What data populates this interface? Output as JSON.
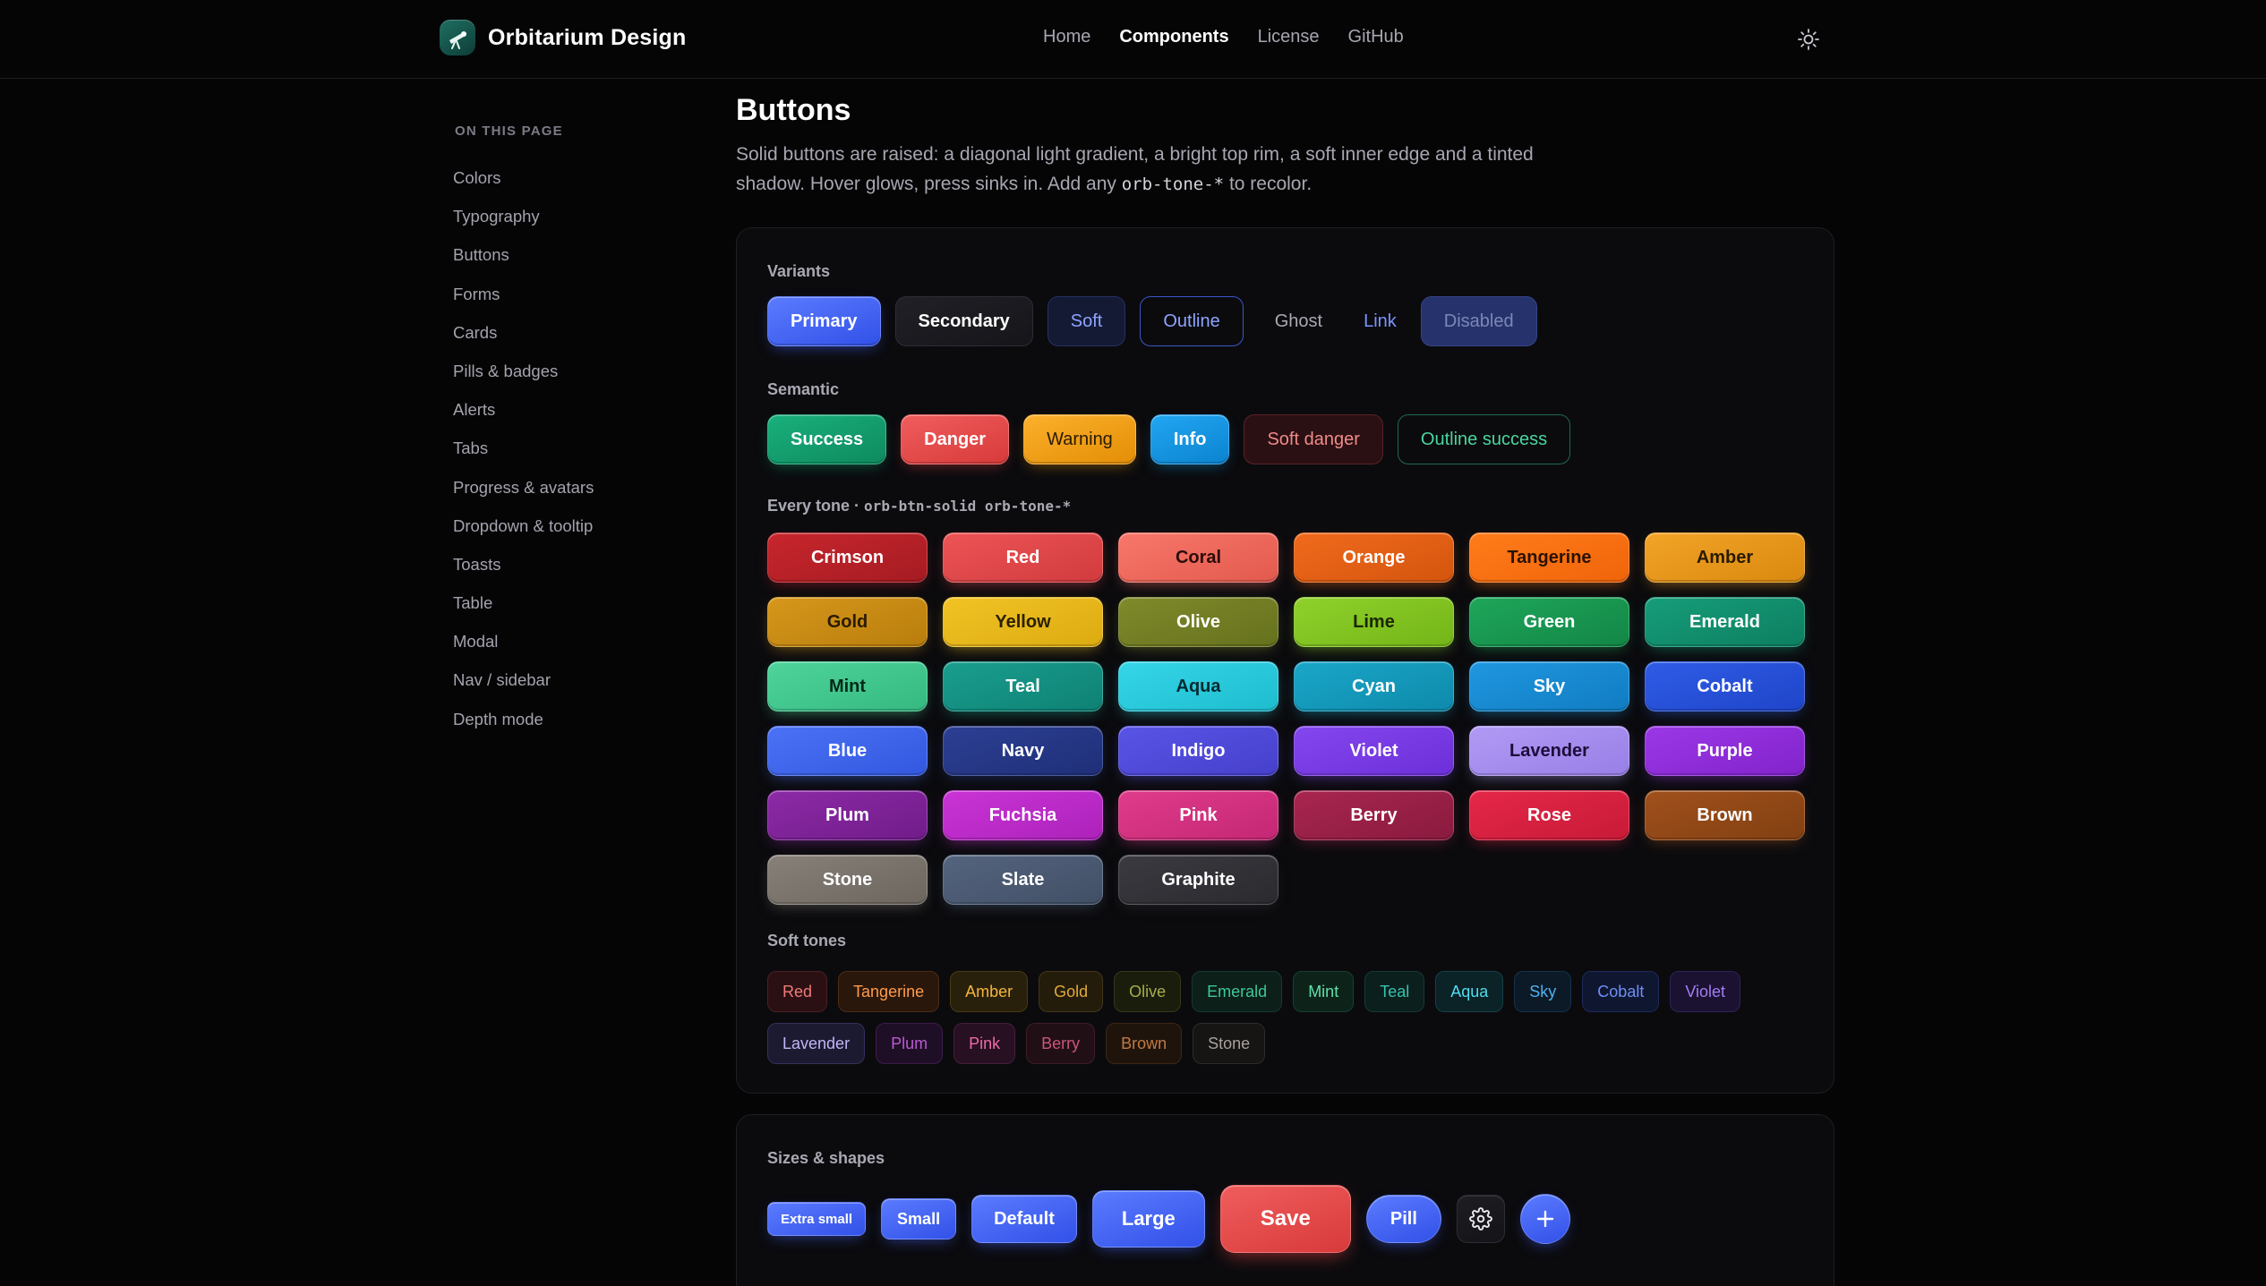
{
  "header": {
    "brand": "Orbitarium Design",
    "nav": [
      "Home",
      "Components",
      "License",
      "GitHub"
    ],
    "active_nav": "Components"
  },
  "sidebar": {
    "title": "ON THIS PAGE",
    "items": [
      "Colors",
      "Typography",
      "Buttons",
      "Forms",
      "Cards",
      "Pills & badges",
      "Alerts",
      "Tabs",
      "Progress & avatars",
      "Dropdown & tooltip",
      "Toasts",
      "Table",
      "Modal",
      "Nav / sidebar",
      "Depth mode"
    ]
  },
  "page": {
    "title": "Buttons",
    "desc_part1": "Solid buttons are raised: a diagonal light gradient, a bright top rim, a soft inner edge and a tinted shadow. Hover glows, press sinks in. Add any ",
    "desc_code": "orb-tone-*",
    "desc_part2": " to recolor."
  },
  "variants": {
    "label": "Variants",
    "primary": "Primary",
    "secondary": "Secondary",
    "soft": "Soft",
    "outline": "Outline",
    "ghost": "Ghost",
    "link": "Link",
    "disabled": "Disabled"
  },
  "semantic": {
    "label": "Semantic",
    "success": "Success",
    "danger": "Danger",
    "warning": "Warning",
    "info": "Info",
    "soft_danger": "Soft danger",
    "outline_success": "Outline success"
  },
  "tones": {
    "label_text": "Every tone · ",
    "label_code": "orb-btn-solid orb-tone-*",
    "items": [
      {
        "name": "Crimson",
        "c1": "#c8262d",
        "c2": "#a51b22",
        "text": "#ffffff"
      },
      {
        "name": "Red",
        "c1": "#ec5456",
        "c2": "#d23b3e",
        "text": "#ffffff"
      },
      {
        "name": "Coral",
        "c1": "#f7776a",
        "c2": "#e35a4e",
        "text": "#2b0c08"
      },
      {
        "name": "Orange",
        "c1": "#f06a1c",
        "c2": "#d4550e",
        "text": "#ffffff"
      },
      {
        "name": "Tangerine",
        "c1": "#ff7c1a",
        "c2": "#f0640a",
        "text": "#2a1200"
      },
      {
        "name": "Amber",
        "c1": "#f2a427",
        "c2": "#d9890f",
        "text": "#2a1a00"
      },
      {
        "name": "Gold",
        "c1": "#d6971b",
        "c2": "#b87d0c",
        "text": "#2a1a00"
      },
      {
        "name": "Yellow",
        "c1": "#f2c325",
        "c2": "#dbab10",
        "text": "#2a2000"
      },
      {
        "name": "Olive",
        "c1": "#7f8a2b",
        "c2": "#66711d",
        "text": "#ffffff"
      },
      {
        "name": "Lime",
        "c1": "#8fd12b",
        "c2": "#74b518",
        "text": "#1a2600"
      },
      {
        "name": "Green",
        "c1": "#1ea65a",
        "c2": "#138646",
        "text": "#ffffff"
      },
      {
        "name": "Emerald",
        "c1": "#169d79",
        "c2": "#0d7f61",
        "text": "#ffffff"
      },
      {
        "name": "Mint",
        "c1": "#4ed49a",
        "c2": "#35b981",
        "text": "#06281a"
      },
      {
        "name": "Teal",
        "c1": "#1a9e8e",
        "c2": "#0e8174",
        "text": "#ffffff"
      },
      {
        "name": "Aqua",
        "c1": "#35d6e8",
        "c2": "#1ebccf",
        "text": "#052a30"
      },
      {
        "name": "Cyan",
        "c1": "#1aa6c8",
        "c2": "#0e8aab",
        "text": "#ffffff"
      },
      {
        "name": "Sky",
        "c1": "#1f97e0",
        "c2": "#117cc2",
        "text": "#ffffff"
      },
      {
        "name": "Cobalt",
        "c1": "#2f5ce6",
        "c2": "#1f45c9",
        "text": "#ffffff"
      },
      {
        "name": "Blue",
        "c1": "#4b72f5",
        "c2": "#3358e0",
        "text": "#ffffff"
      },
      {
        "name": "Navy",
        "c1": "#2c3f93",
        "c2": "#1f2f78",
        "text": "#ffffff"
      },
      {
        "name": "Indigo",
        "c1": "#5a54e6",
        "c2": "#4640cc",
        "text": "#ffffff"
      },
      {
        "name": "Violet",
        "c1": "#8446ee",
        "c2": "#6d30d8",
        "text": "#ffffff"
      },
      {
        "name": "Lavender",
        "c1": "#b19af5",
        "c2": "#987fe6",
        "text": "#1c0d3a"
      },
      {
        "name": "Purple",
        "c1": "#9b38e6",
        "c2": "#8223cc",
        "text": "#ffffff"
      },
      {
        "name": "Plum",
        "c1": "#8c2aa6",
        "c2": "#711c8a",
        "text": "#ffffff"
      },
      {
        "name": "Fuchsia",
        "c1": "#c934d6",
        "c2": "#ad22ba",
        "text": "#ffffff"
      },
      {
        "name": "Pink",
        "c1": "#e03c8c",
        "c2": "#c42773",
        "text": "#ffffff"
      },
      {
        "name": "Berry",
        "c1": "#a8264f",
        "c2": "#8a1a3f",
        "text": "#ffffff"
      },
      {
        "name": "Rose",
        "c1": "#e52748",
        "c2": "#c81a38",
        "text": "#ffffff"
      },
      {
        "name": "Brown",
        "c1": "#a0501c",
        "c2": "#824012",
        "text": "#ffffff"
      },
      {
        "name": "Stone",
        "c1": "#878078",
        "c2": "#6c665f",
        "text": "#ffffff"
      },
      {
        "name": "Slate",
        "c1": "#55647e",
        "c2": "#414f66",
        "text": "#ffffff"
      },
      {
        "name": "Graphite",
        "c1": "#3a3a40",
        "c2": "#2a2a2f",
        "text": "#ffffff"
      }
    ]
  },
  "soft_tones": {
    "label": "Soft tones",
    "items": [
      {
        "name": "Red",
        "bg": "#2a1012",
        "fg": "#f07a7a",
        "bd": "#4d1e22"
      },
      {
        "name": "Tangerine",
        "bg": "#2a170b",
        "fg": "#ff9a4d",
        "bd": "#4d2c14"
      },
      {
        "name": "Amber",
        "bg": "#28200b",
        "fg": "#f5b53c",
        "bd": "#4a3a14"
      },
      {
        "name": "Gold",
        "bg": "#241c0b",
        "fg": "#e0a93a",
        "bd": "#43351a"
      },
      {
        "name": "Olive",
        "bg": "#1b1d0c",
        "fg": "#a5ae4c",
        "bd": "#34381b"
      },
      {
        "name": "Emerald",
        "bg": "#0c1f19",
        "fg": "#3fc79b",
        "bd": "#17392e"
      },
      {
        "name": "Mint",
        "bg": "#0d231a",
        "fg": "#5fe0a8",
        "bd": "#18402f"
      },
      {
        "name": "Teal",
        "bg": "#0b1f1d",
        "fg": "#35c3b1",
        "bd": "#163a36"
      },
      {
        "name": "Aqua",
        "bg": "#0b2226",
        "fg": "#50dcee",
        "bd": "#154048"
      },
      {
        "name": "Sky",
        "bg": "#0b1a26",
        "fg": "#4fb0f2",
        "bd": "#163248"
      },
      {
        "name": "Cobalt",
        "bg": "#0f1630",
        "fg": "#6f8ff5",
        "bd": "#1d2a5a"
      },
      {
        "name": "Violet",
        "bg": "#1a1230",
        "fg": "#a47cf5",
        "bd": "#30225a"
      },
      {
        "name": "Lavender",
        "bg": "#1c1a30",
        "fg": "#c3b4f7",
        "bd": "#35305a"
      },
      {
        "name": "Plum",
        "bg": "#1f0f26",
        "fg": "#b85ad2",
        "bd": "#3a1c48"
      },
      {
        "name": "Pink",
        "bg": "#261021",
        "fg": "#ef6aaa",
        "bd": "#481e3d"
      },
      {
        "name": "Berry",
        "bg": "#210f16",
        "fg": "#c9557a",
        "bd": "#3e1c29"
      },
      {
        "name": "Brown",
        "bg": "#1f140c",
        "fg": "#c27a45",
        "bd": "#3b2616"
      },
      {
        "name": "Stone",
        "bg": "#161514",
        "fg": "#a8a29b",
        "bd": "#2e2c2a"
      }
    ]
  },
  "sizes": {
    "label": "Sizes & shapes",
    "xs": "Extra small",
    "sm": "Small",
    "default": "Default",
    "lg": "Large",
    "save": "Save",
    "pill": "Pill"
  }
}
